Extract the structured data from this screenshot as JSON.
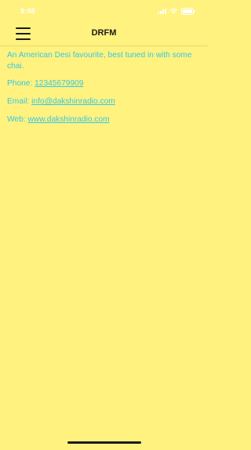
{
  "status_bar": {
    "time": "9:48",
    "icons": [
      "signal-icon",
      "wifi-icon",
      "battery-icon"
    ]
  },
  "nav": {
    "title": "DRFM",
    "menu_icon": "hamburger-icon"
  },
  "content": {
    "description": "An American Desi favourite, best tuned in with some chai.",
    "phone_label": "Phone: ",
    "phone_value": "12345679909",
    "email_label": "Email: ",
    "email_value": "info@dakshinradio.com",
    "web_label": "Web: ",
    "web_value": "www.dakshinradio.com"
  },
  "colors": {
    "background": "#fff27f",
    "text_accent": "#36c8e6",
    "title": "#1a1a1a"
  }
}
